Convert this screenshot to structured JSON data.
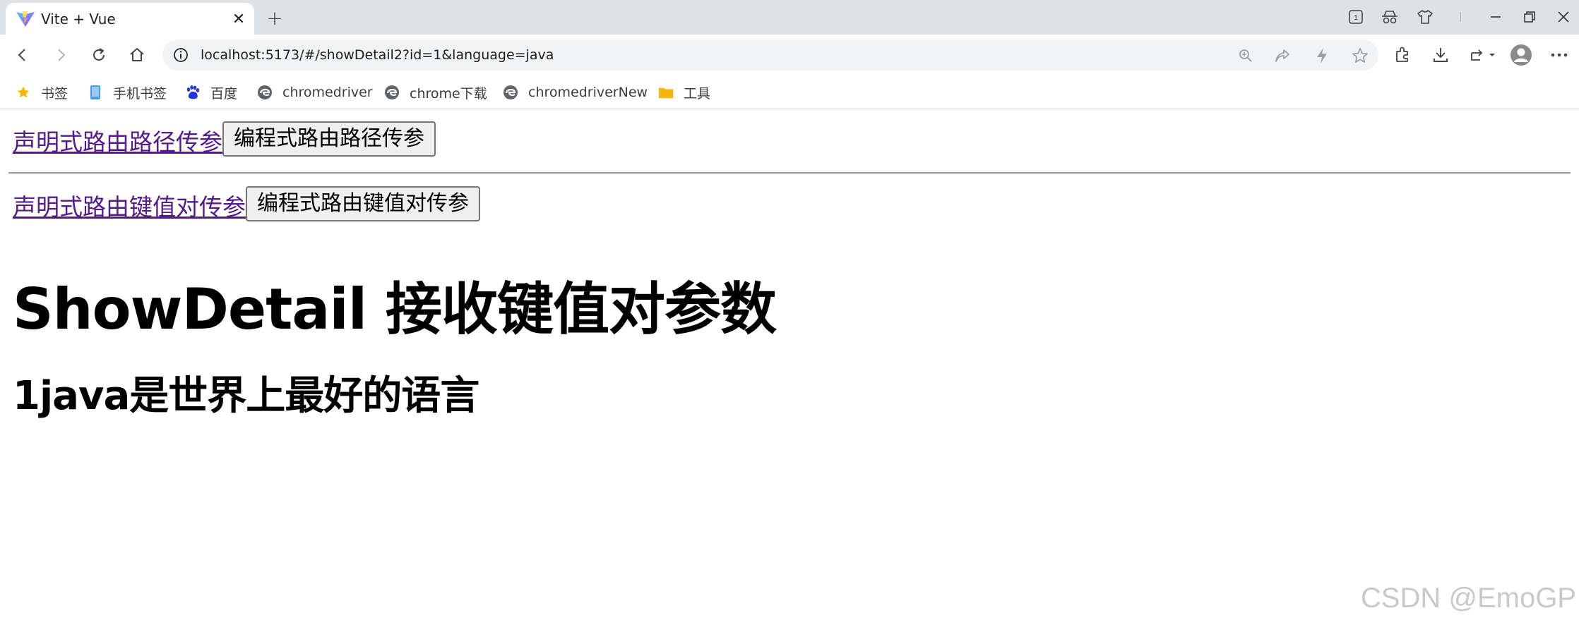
{
  "browser": {
    "tab": {
      "title": "Vite + Vue",
      "close_glyph": "✕",
      "favicon": "vite-logo"
    },
    "new_tab_glyph": "+",
    "window_controls": [
      "tab-counter-icon",
      "incognito-icon",
      "shirt-icon",
      "divider",
      "minimize-icon",
      "restore-icon",
      "close-icon"
    ],
    "toolbar": {
      "buttons": [
        "back-icon",
        "forward-icon",
        "reload-icon",
        "home-icon"
      ],
      "omnibox": {
        "url": "localhost:5173/#/showDetail2?id=1&language=java",
        "icons": [
          "zoom-icon",
          "share-icon",
          "bolt-icon",
          "star-icon"
        ]
      },
      "right_buttons": [
        "extensions-icon",
        "download-icon",
        "sync-icon",
        "profile-icon",
        "more-icon"
      ]
    },
    "bookmarks": [
      {
        "label": "书签",
        "icon": "star-icon",
        "color": "#f4b400"
      },
      {
        "label": "手机书签",
        "icon": "phone-icon",
        "color": "#4a9be8"
      },
      {
        "label": "百度",
        "icon": "baidu-paw-icon",
        "color": "#2932e1"
      },
      {
        "label": "chromedriver",
        "icon": "edge-icon",
        "color": "#5f6368"
      },
      {
        "label": "chrome下载",
        "icon": "edge-icon",
        "color": "#5f6368"
      },
      {
        "label": "chromedriverNew",
        "icon": "edge-icon",
        "color": "#5f6368"
      },
      {
        "label": "工具",
        "icon": "folder-icon",
        "color": "#f6b40e"
      }
    ]
  },
  "content": {
    "row1": {
      "link": "声明式路由路径传参",
      "button": "编程式路由路径传参"
    },
    "row2": {
      "link": "声明式路由键值对传参",
      "button": "编程式路由键值对传参"
    },
    "heading": "ShowDetail 接收键值对参数",
    "subheading": "1java是世界上最好的语言",
    "link_color": "#551a8b"
  },
  "watermark": "CSDN @EmoGP"
}
